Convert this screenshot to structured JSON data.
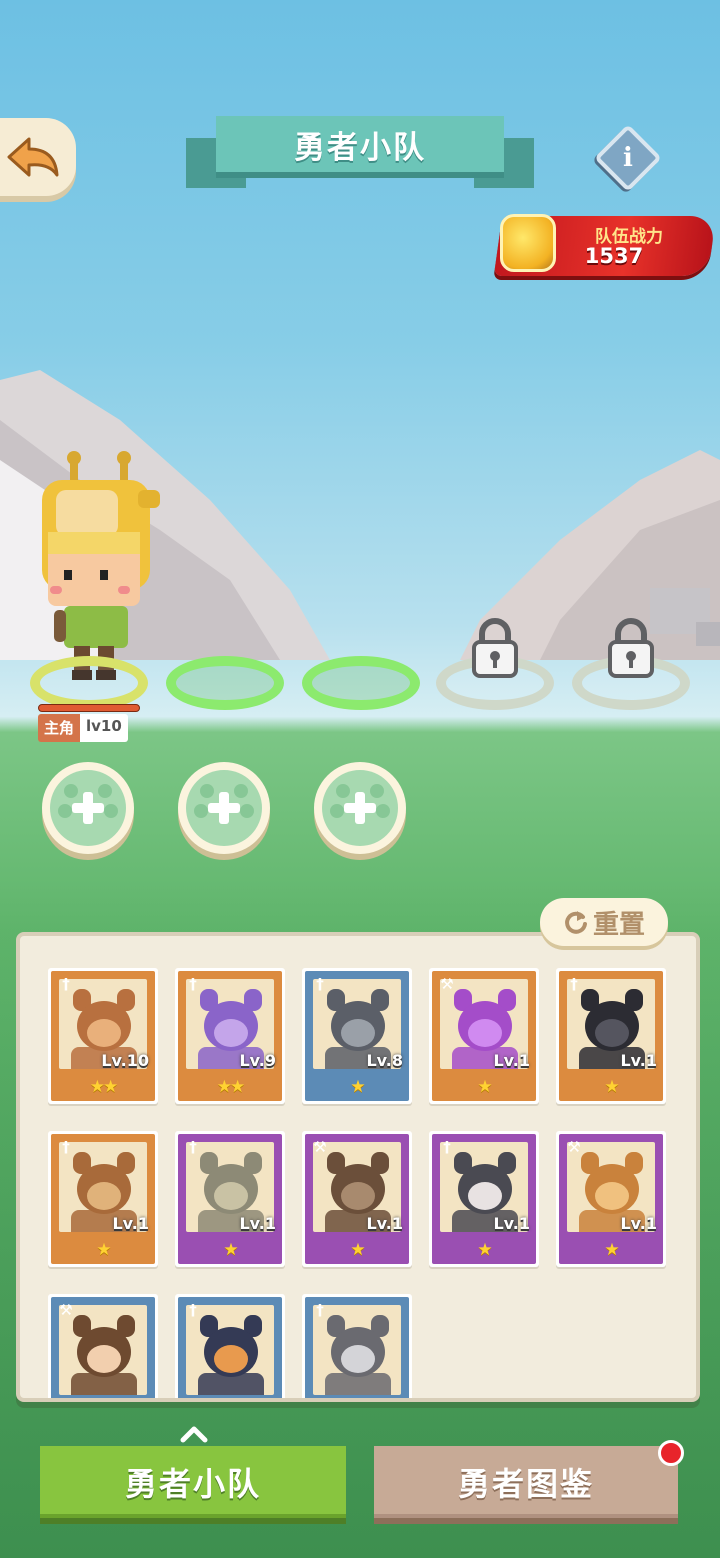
{
  "header": {
    "title": "勇者小队",
    "back_icon": "back-arrow-icon",
    "info_icon": "info-icon",
    "info_glyph": "i"
  },
  "team_power": {
    "label": "队伍战力",
    "value": "1537"
  },
  "lineup": {
    "leader": {
      "role": "主角",
      "level": "lv10",
      "hp_fraction": 1.0
    },
    "slots": [
      "leader",
      "open",
      "open",
      "locked",
      "locked"
    ],
    "add_buttons": 3
  },
  "roster": {
    "reset_label": "重置",
    "reset_icon": "refresh-icon",
    "cards": [
      {
        "level": "Lv.10",
        "stars": "★★",
        "frame": "orange",
        "role": "sword"
      },
      {
        "level": "Lv.9",
        "stars": "★★",
        "frame": "orange",
        "role": "sword"
      },
      {
        "level": "Lv.8",
        "stars": "★",
        "frame": "blue",
        "role": "sword"
      },
      {
        "level": "Lv.1",
        "stars": "★",
        "frame": "orange",
        "role": "hammer"
      },
      {
        "level": "Lv.1",
        "stars": "★",
        "frame": "orange",
        "role": "sword"
      },
      {
        "level": "Lv.1",
        "stars": "★",
        "frame": "orange",
        "role": "sword"
      },
      {
        "level": "Lv.1",
        "stars": "★",
        "frame": "purple",
        "role": "sword"
      },
      {
        "level": "Lv.1",
        "stars": "★",
        "frame": "purple",
        "role": "hammer"
      },
      {
        "level": "Lv.1",
        "stars": "★",
        "frame": "purple",
        "role": "sword"
      },
      {
        "level": "Lv.1",
        "stars": "★",
        "frame": "purple",
        "role": "hammer"
      },
      {
        "level": "",
        "stars": "",
        "frame": "blue",
        "role": "hammer"
      },
      {
        "level": "",
        "stars": "",
        "frame": "blue",
        "role": "sword"
      },
      {
        "level": "",
        "stars": "",
        "frame": "blue",
        "role": "sword"
      }
    ]
  },
  "tabs": {
    "squad": "勇者小队",
    "codex": "勇者图鉴",
    "active": "squad"
  },
  "colors": {
    "active_tab": "#88c53f",
    "inactive_tab": "#c7aa96",
    "power_badge": "#e8322a",
    "notification": "#e8242b"
  }
}
